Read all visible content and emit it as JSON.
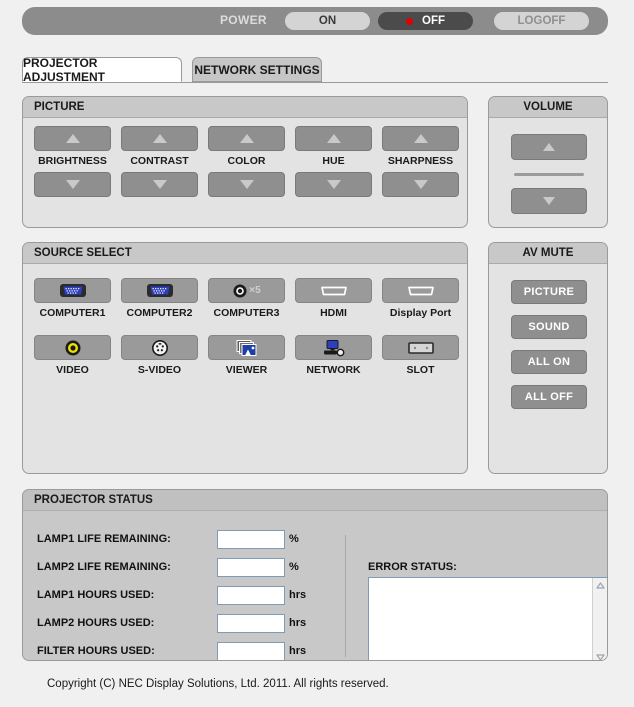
{
  "powerbar": {
    "label": "POWER",
    "on_label": "ON",
    "off_label": "OFF",
    "logoff_label": "LOGOFF",
    "status_indicator": "power-off-dot",
    "dot_color": "#e00000",
    "selected": "OFF"
  },
  "tabs": [
    {
      "label": "PROJECTOR ADJUSTMENT",
      "active": true
    },
    {
      "label": "NETWORK SETTINGS",
      "active": false
    }
  ],
  "picture": {
    "title": "PICTURE",
    "up_icon": "triangle-up-icon",
    "down_icon": "triangle-down-icon",
    "items": [
      {
        "label": "BRIGHTNESS"
      },
      {
        "label": "CONTRAST"
      },
      {
        "label": "COLOR"
      },
      {
        "label": "HUE"
      },
      {
        "label": "SHARPNESS"
      }
    ]
  },
  "volume": {
    "title": "VOLUME",
    "up_icon": "triangle-up-icon",
    "down_icon": "triangle-down-icon"
  },
  "source_select": {
    "title": "SOURCE SELECT",
    "row1": [
      {
        "label": "COMPUTER1",
        "icon": "vga-connector-icon"
      },
      {
        "label": "COMPUTER2",
        "icon": "vga-connector-icon"
      },
      {
        "label": "COMPUTER3",
        "icon": "bnc-x5-icon",
        "icon_text": "×5"
      },
      {
        "label": "HDMI",
        "icon": "hdmi-port-icon"
      },
      {
        "label": "Display Port",
        "icon": "displayport-icon"
      }
    ],
    "row2": [
      {
        "label": "VIDEO",
        "icon": "rca-video-icon"
      },
      {
        "label": "S-VIDEO",
        "icon": "s-video-din-icon"
      },
      {
        "label": "VIEWER",
        "icon": "stacked-images-icon"
      },
      {
        "label": "NETWORK",
        "icon": "network-monitor-icon"
      },
      {
        "label": "SLOT",
        "icon": "card-slot-icon"
      }
    ]
  },
  "av_mute": {
    "title": "AV MUTE",
    "buttons": [
      {
        "label": "PICTURE"
      },
      {
        "label": "SOUND"
      },
      {
        "label": "ALL ON"
      },
      {
        "label": "ALL OFF"
      }
    ]
  },
  "projector_status": {
    "title": "PROJECTOR STATUS",
    "rows": [
      {
        "label": "LAMP1 LIFE REMAINING:",
        "value": "",
        "unit": "%"
      },
      {
        "label": "LAMP2 LIFE REMAINING:",
        "value": "",
        "unit": "%"
      },
      {
        "label": "LAMP1 HOURS USED:",
        "value": "",
        "unit": "hrs"
      },
      {
        "label": "LAMP2 HOURS USED:",
        "value": "",
        "unit": "hrs"
      },
      {
        "label": "FILTER HOURS USED:",
        "value": "",
        "unit": "hrs"
      }
    ],
    "error_status": {
      "label": "ERROR STATUS:",
      "value": "",
      "scroll_up_icon": "chevron-up-icon",
      "scroll_down_icon": "chevron-down-icon"
    }
  },
  "footer": {
    "copyright": "Copyright (C) NEC Display Solutions, Ltd. 2011. All rights reserved."
  }
}
